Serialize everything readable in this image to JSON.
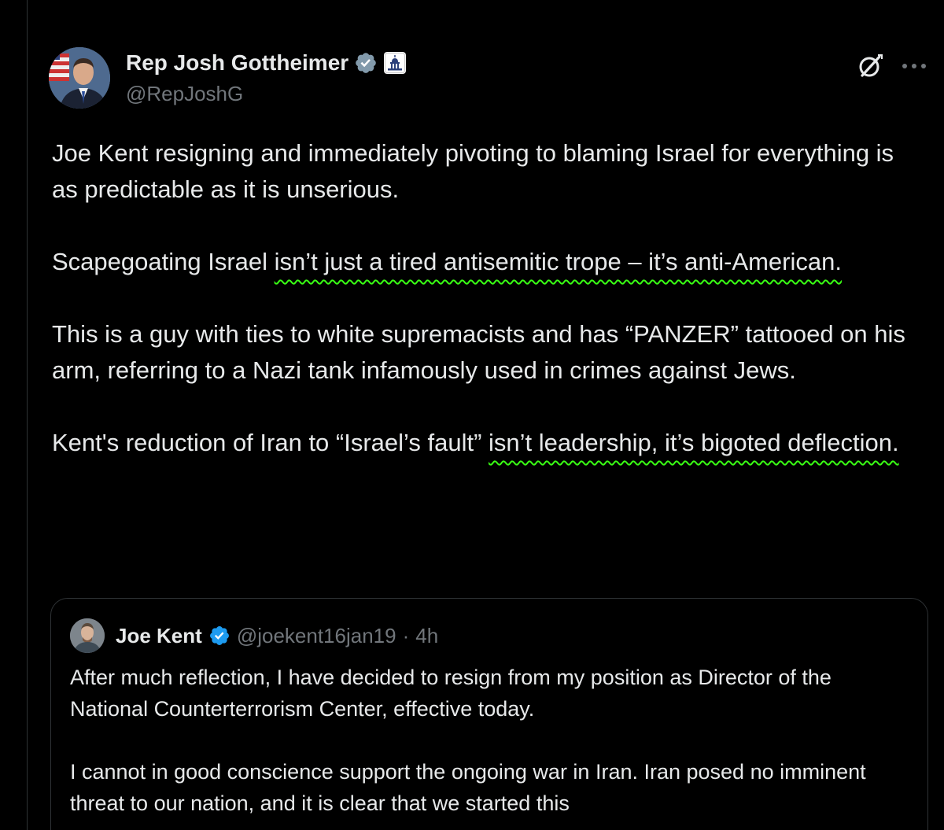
{
  "author": {
    "display_name": "Rep Josh Gottheimer",
    "handle": "@RepJoshG",
    "verified_icon": "verified-badge-icon",
    "affiliation_icon": "us-capitol-icon"
  },
  "actions": {
    "grok_icon": "grok-icon",
    "more_icon": "more-options-icon"
  },
  "post": {
    "p1": "Joe Kent resigning and immediately pivoting to blaming Israel for everything is as predictable as it is unserious.",
    "p2_start": "Scapegoating Israel ",
    "p2_underlined": "isn’t just a tired antisemitic trope – it’s anti-American.",
    "p3": "This is a guy with ties to white supremacists and has “PANZER” tattooed on his arm, referring to a Nazi tank infamously used in crimes against Jews.",
    "p4_start": "Kent's reduction of Iran to “Israel’s fault” ",
    "p4_underlined": "isn’t leadership, it’s bigoted deflection."
  },
  "quote": {
    "display_name": "Joe Kent",
    "handle": "@joekent16jan19",
    "separator": "·",
    "time": "4h",
    "p1": "After much reflection, I have decided to resign from my position as Director of the National Counterterrorism Center, effective today.",
    "p2": "I cannot in good conscience support the ongoing war in Iran. Iran posed no imminent threat to our nation, and it is clear that we started this"
  },
  "colors": {
    "background": "#000000",
    "text": "#e7e9ea",
    "muted": "#71767b",
    "verified": "#1d9bf0",
    "highlight_underline": "#39ff14",
    "border": "#2f3336"
  }
}
